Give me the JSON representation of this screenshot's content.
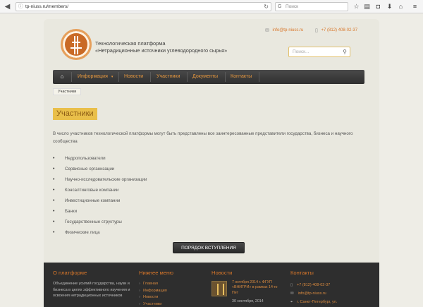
{
  "browser": {
    "url": "tp-niuss.ru/members/",
    "search_placeholder": "Поиск",
    "google_label": "G"
  },
  "header": {
    "title_line1": "Технологическая платформа",
    "title_line2": "«Нетрадиционные источники углеводородного сырья»",
    "email": "info@tp-niuss.ru",
    "phone": "+7 (812) 408-02-37",
    "search_placeholder": "Поиск..."
  },
  "nav": {
    "items": [
      {
        "label": "Информация"
      },
      {
        "label": "Новости"
      },
      {
        "label": "Участники"
      },
      {
        "label": "Документы"
      },
      {
        "label": "Контакты"
      }
    ]
  },
  "breadcrumb": "Участники",
  "page": {
    "heading": "Участники",
    "intro": "В число участников технологической платформы могут быть представлены все заинтересованные представители государства, бизнеса и научного сообщества",
    "participants": [
      "Недропользователи",
      "Сервисные организации",
      "Научно-исследовательские организации",
      "Консалтинговые компании",
      "Инвестиционные компании",
      "Банки",
      "Государственные структуры",
      "Физические лица"
    ],
    "join_button": "ПОРЯДОК ВСТУПЛЕНИЯ"
  },
  "footer": {
    "about": {
      "title": "О платформе",
      "text": "Объединение усилий государства, науки и бизнеса в целях эффективного изучения и освоения нетрадиционных источников"
    },
    "menu": {
      "title": "Нижнее меню",
      "links": [
        "Главная",
        "Информация",
        "Новости",
        "Участники"
      ]
    },
    "news": {
      "title": "Новости",
      "item_text": "7 октября 2014 г. ФГУП «ВНИГРИ» в рамках 14-го Пет",
      "item_date": "30 сентября, 2014"
    },
    "contacts": {
      "title": "Контакты",
      "phone": "+7 (812) 408-02-37",
      "email": "info@tp-niuss.ru",
      "address": "г. Санкт-Петербург, ул."
    }
  }
}
